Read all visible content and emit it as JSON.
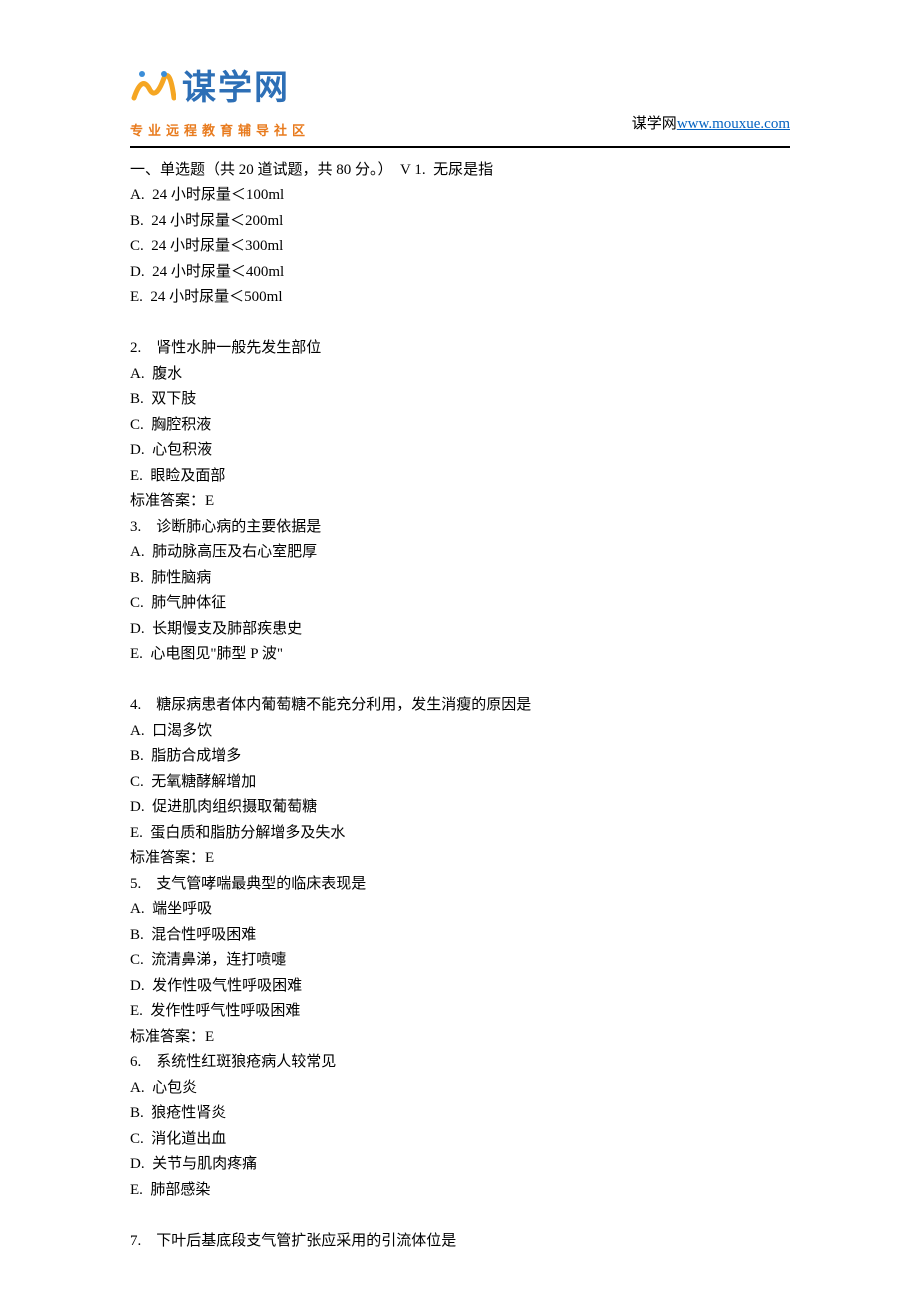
{
  "header": {
    "logo_main": "谋学网",
    "logo_sub": "专业远程教育辅导社区",
    "site_label": "谋学网",
    "site_url": "www.mouxue.com"
  },
  "section_header": "一、单选题（共 20 道试题，共 80 分。）  V 1.  无尿是指",
  "questions": [
    {
      "stem_extra": "",
      "options": [
        "A.  24 小时尿量＜100ml",
        "B.  24 小时尿量＜200ml",
        "C.  24 小时尿量＜300ml",
        "D.  24 小时尿量＜400ml",
        "E.  24 小时尿量＜500ml"
      ],
      "answer": ""
    },
    {
      "stem": "2.    肾性水肿一般先发生部位",
      "options": [
        "A.  腹水",
        "B.  双下肢",
        "C.  胸腔积液",
        "D.  心包积液",
        "E.  眼睑及面部"
      ],
      "answer": "标准答案：E"
    },
    {
      "stem": "3.    诊断肺心病的主要依据是",
      "options": [
        "A.  肺动脉高压及右心室肥厚",
        "B.  肺性脑病",
        "C.  肺气肿体征",
        "D.  长期慢支及肺部疾患史",
        "E.  心电图见\"肺型 P 波\""
      ],
      "answer": ""
    },
    {
      "stem": "4.    糖尿病患者体内葡萄糖不能充分利用，发生消瘦的原因是",
      "options": [
        "A.  口渴多饮",
        "B.  脂肪合成增多",
        "C.  无氧糖酵解增加",
        "D.  促进肌肉组织摄取葡萄糖",
        "E.  蛋白质和脂肪分解增多及失水"
      ],
      "answer": "标准答案：E"
    },
    {
      "stem": "5.    支气管哮喘最典型的临床表现是",
      "options": [
        "A.  端坐呼吸",
        "B.  混合性呼吸困难",
        "C.  流清鼻涕，连打喷嚏",
        "D.  发作性吸气性呼吸困难",
        "E.  发作性呼气性呼吸困难"
      ],
      "answer": "标准答案：E"
    },
    {
      "stem": "6.    系统性红斑狼疮病人较常见",
      "options": [
        "A.  心包炎",
        "B.  狼疮性肾炎",
        "C.  消化道出血",
        "D.  关节与肌肉疼痛",
        "E.  肺部感染"
      ],
      "answer": ""
    },
    {
      "stem": "7.    下叶后基底段支气管扩张应采用的引流体位是",
      "options": [],
      "answer": ""
    }
  ]
}
